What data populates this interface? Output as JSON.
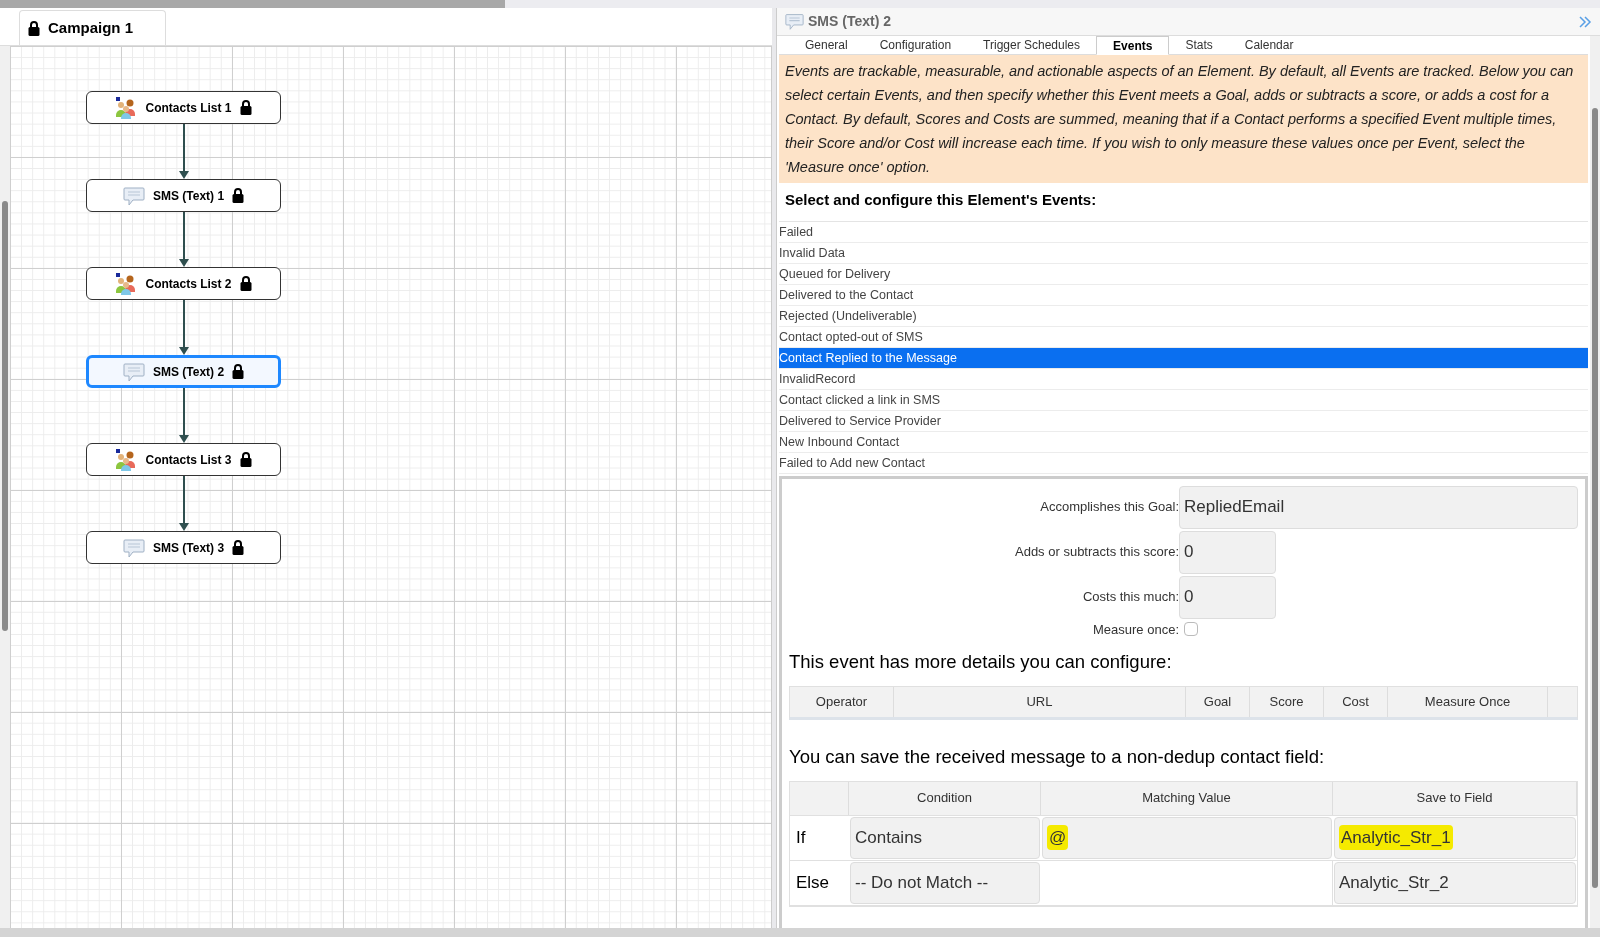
{
  "canvas": {
    "tab": {
      "title": "Campaign 1",
      "locked": true
    },
    "nodes": [
      {
        "kind": "contacts",
        "label": "Contacts List 1",
        "locked": true,
        "selected": false
      },
      {
        "kind": "sms",
        "label": "SMS (Text) 1",
        "locked": true,
        "selected": false
      },
      {
        "kind": "contacts",
        "label": "Contacts List 2",
        "locked": true,
        "selected": false
      },
      {
        "kind": "sms",
        "label": "SMS (Text) 2",
        "locked": true,
        "selected": true
      },
      {
        "kind": "contacts",
        "label": "Contacts List 3",
        "locked": true,
        "selected": false
      },
      {
        "kind": "sms",
        "label": "SMS (Text) 3",
        "locked": true,
        "selected": false
      }
    ]
  },
  "panel": {
    "title": "SMS (Text) 2",
    "tabs": [
      {
        "label": "General",
        "selected": false
      },
      {
        "label": "Configuration",
        "selected": false
      },
      {
        "label": "Trigger Schedules",
        "selected": false
      },
      {
        "label": "Events",
        "selected": true
      },
      {
        "label": "Stats",
        "selected": false
      },
      {
        "label": "Calendar",
        "selected": false
      }
    ],
    "info": "Events are trackable, measurable, and actionable aspects of an Element. By default, all Events are tracked. Below you can select certain Events, and then specify whether this Event meets a Goal, adds or subtracts a score, or adds a cost for a Contact. By default, Scores and Costs are summed, meaning that if a Contact performs a specified Event multiple times, their Score and/or Cost will increase each time. If you wish to only measure these values once per Event, select the 'Measure once' option.",
    "events_heading": "Select and configure this Element's Events:",
    "events": [
      {
        "label": "Failed",
        "selected": false
      },
      {
        "label": "Invalid Data",
        "selected": false
      },
      {
        "label": "Queued for Delivery",
        "selected": false
      },
      {
        "label": "Delivered to the Contact",
        "selected": false
      },
      {
        "label": "Rejected (Undeliverable)",
        "selected": false
      },
      {
        "label": "Contact opted-out of SMS",
        "selected": false
      },
      {
        "label": "Contact Replied to the Message",
        "selected": true
      },
      {
        "label": "InvalidRecord",
        "selected": false
      },
      {
        "label": "Contact clicked a link in SMS",
        "selected": false
      },
      {
        "label": "Delivered to Service Provider",
        "selected": false
      },
      {
        "label": "New Inbound Contact",
        "selected": false
      },
      {
        "label": "Failed to Add new Contact",
        "selected": false
      }
    ],
    "form": {
      "goal": {
        "label": "Accomplishes this Goal:",
        "value": "RepliedEmail"
      },
      "score": {
        "label": "Adds or subtracts this score:",
        "value": "0"
      },
      "cost": {
        "label": "Costs this much:",
        "value": "0"
      },
      "measure_once": {
        "label": "Measure once:",
        "checked": false
      }
    },
    "details_heading": "This event has more details you can configure:",
    "details_table": {
      "columns": [
        "Operator",
        "URL",
        "Goal",
        "Score",
        "Cost",
        "Measure Once"
      ]
    },
    "save_heading": "You can save the received message to a non-dedup contact field:",
    "save_table": {
      "columns": [
        "Condition",
        "Matching Value",
        "Save to Field"
      ],
      "rows": [
        {
          "label": "If",
          "cells": [
            {
              "kind": "field",
              "text": "Contains",
              "highlighted": false
            },
            {
              "kind": "field",
              "text": "@",
              "highlighted": true
            },
            {
              "kind": "field",
              "text": "Analytic_Str_1",
              "highlighted": true
            }
          ]
        },
        {
          "label": "Else",
          "cells": [
            {
              "kind": "field",
              "text": "-- Do not Match --",
              "highlighted": false
            },
            {
              "kind": "blank"
            },
            {
              "kind": "field",
              "text": "Analytic_Str_2",
              "highlighted": false
            }
          ]
        }
      ]
    }
  }
}
